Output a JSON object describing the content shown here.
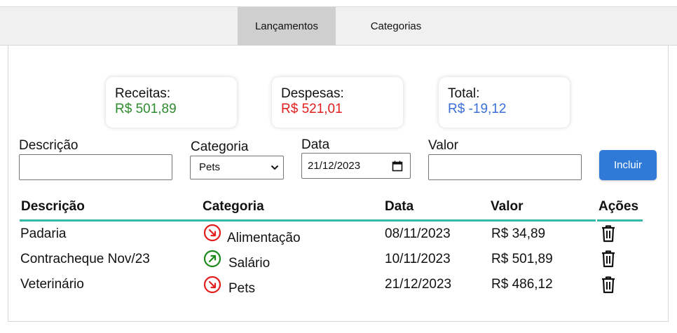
{
  "nav": {
    "tabs": [
      {
        "label": "Lançamentos",
        "active": true
      },
      {
        "label": "Categorias",
        "active": false
      }
    ]
  },
  "summary": {
    "receitas": {
      "label": "Receitas:",
      "value": "R$ 501,89",
      "color": "#2e8b2e"
    },
    "despesas": {
      "label": "Despesas:",
      "value": "R$ 521,01",
      "color": "#e11d1d"
    },
    "total": {
      "label": "Total:",
      "value": "R$ -19,12",
      "color": "#3b6ed6"
    }
  },
  "form": {
    "descricao_label": "Descrição",
    "descricao_value": "",
    "categoria_label": "Categoria",
    "categoria_value": "Pets",
    "data_label": "Data",
    "data_value": "21/12/2023",
    "valor_label": "Valor",
    "valor_value": "",
    "submit_label": "Incluir"
  },
  "table": {
    "headers": [
      "Descrição",
      "Categoria",
      "Data",
      "Valor",
      "Ações"
    ],
    "rows": [
      {
        "descricao": "Padaria",
        "categoria": "Alimentação",
        "tipo": "despesa",
        "data": "08/11/2023",
        "valor": "R$ 34,89"
      },
      {
        "descricao": "Contracheque Nov/23",
        "categoria": "Salário",
        "tipo": "receita",
        "data": "10/11/2023",
        "valor": "R$ 501,89"
      },
      {
        "descricao": "Veterinário",
        "categoria": "Pets",
        "tipo": "despesa",
        "data": "21/12/2023",
        "valor": "R$ 486,12"
      }
    ]
  },
  "colors": {
    "accent_line": "#35b9a7",
    "button": "#2f7ad6",
    "expense_icon": "#e11d1d",
    "income_icon": "#1a8a1a"
  },
  "icons": {
    "expense": "arrow-down-right-circle-icon",
    "income": "arrow-up-right-circle-icon",
    "delete": "trash-icon",
    "select": "chevron-down-icon",
    "date": "calendar-icon"
  }
}
